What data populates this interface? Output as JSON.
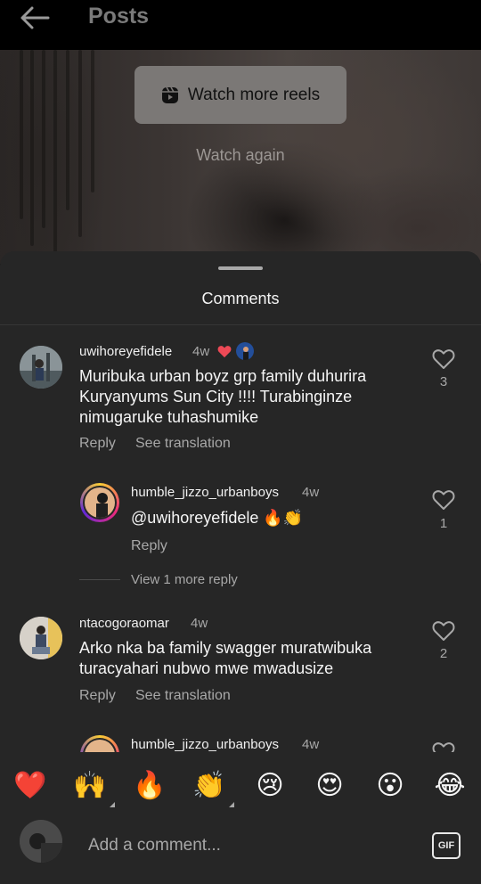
{
  "header": {
    "title": "Posts"
  },
  "reel": {
    "watch_more_label": "Watch more reels",
    "watch_again_label": "Watch again"
  },
  "comments_sheet": {
    "title": "Comments",
    "comments": [
      {
        "username": "uwihoreyefidele",
        "time": "4w",
        "text": "Muribuka urban boyz grp family duhurira Kuryanyums Sun City !!!! Turabinginze nimugaruke tuhashumike",
        "likes": "3",
        "reply_label": "Reply",
        "translate_label": "See translation",
        "reply": {
          "username": "humble_jizzo_urbanboys",
          "time": "4w",
          "text": "@uwihoreyefidele 🔥👏",
          "likes": "1",
          "reply_label": "Reply"
        },
        "view_more_label": "View 1 more reply"
      },
      {
        "username": "ntacogoraomar",
        "time": "4w",
        "text": "Arko nka ba family swagger muratwibuka turacyahari nubwo mwe mwadusize",
        "likes": "2",
        "reply_label": "Reply",
        "translate_label": "See translation",
        "reply": {
          "username": "humble_jizzo_urbanboys",
          "time": "4w"
        }
      }
    ],
    "reactions": [
      "❤️",
      "🙌",
      "🔥",
      "👏",
      "😢",
      "😍",
      "😮",
      "😂"
    ],
    "input_placeholder": "Add a comment...",
    "gif_label": "GIF"
  },
  "colors": {
    "sheet_bg": "#262626",
    "secondary_text": "#a8a8a8",
    "heart": "#ed4956"
  }
}
